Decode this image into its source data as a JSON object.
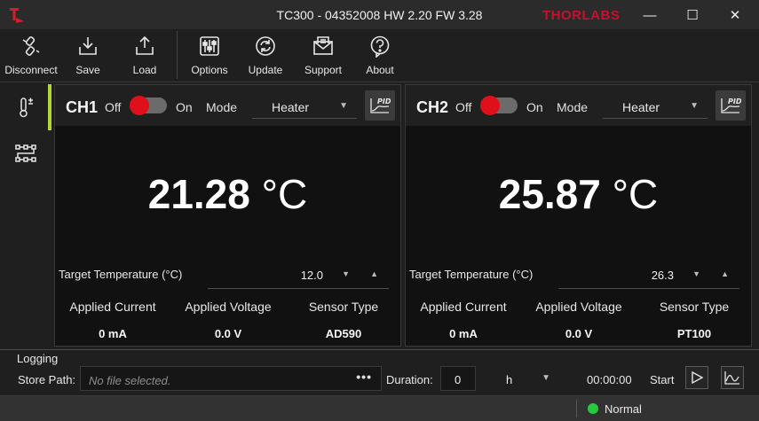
{
  "window": {
    "title": "TC300 - 04352008 HW 2.20 FW 3.28",
    "brand": "THORLABS",
    "minimize": "—",
    "maximize": "☐",
    "close": "✕"
  },
  "toolbar": {
    "disconnect": "Disconnect",
    "save": "Save",
    "load": "Load",
    "options": "Options",
    "update": "Update",
    "support": "Support",
    "about": "About"
  },
  "nav": {
    "items": [
      "temperature-control-icon",
      "logging-sequence-icon"
    ]
  },
  "channels": [
    {
      "label": "CH1",
      "switch_off": "Off",
      "switch_on": "On",
      "enabled": false,
      "mode_label": "Mode",
      "mode": "Heater",
      "temperature": "21.28",
      "temperature_unit": "°C",
      "target_label": "Target Temperature (°C)",
      "target_value": "12.0",
      "applied_current_label": "Applied Current",
      "applied_current": "0 mA",
      "applied_voltage_label": "Applied Voltage",
      "applied_voltage": "0.0 V",
      "sensor_type_label": "Sensor Type",
      "sensor_type": "AD590"
    },
    {
      "label": "CH2",
      "switch_off": "Off",
      "switch_on": "On",
      "enabled": false,
      "mode_label": "Mode",
      "mode": "Heater",
      "temperature": "25.87",
      "temperature_unit": "°C",
      "target_label": "Target Temperature (°C)",
      "target_value": "26.3",
      "applied_current_label": "Applied Current",
      "applied_current": "0 mA",
      "applied_voltage_label": "Applied Voltage",
      "applied_voltage": "0.0 V",
      "sensor_type_label": "Sensor Type",
      "sensor_type": "PT100"
    }
  ],
  "logging": {
    "title": "Logging",
    "store_path_label": "Store Path:",
    "store_path_placeholder": "No file selected.",
    "browse": "•••",
    "duration_label": "Duration:",
    "duration_value": "0",
    "duration_unit": "h",
    "elapsed": "00:00:00",
    "start_label": "Start"
  },
  "status": {
    "text": "Normal",
    "color": "#27c93f"
  },
  "colors": {
    "accent": "#b4d63a",
    "toggle_knob": "#e0101a",
    "brand": "#c8102e"
  }
}
